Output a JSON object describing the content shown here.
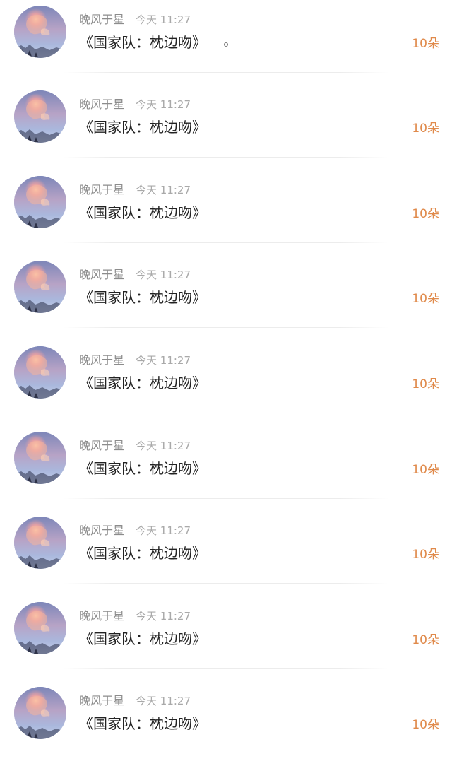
{
  "gift_list": {
    "items": [
      {
        "username": "晚风于星",
        "time": "今天 11:27",
        "message": "《国家队：枕边吻》",
        "amount": "10朵"
      },
      {
        "username": "晚风于星",
        "time": "今天 11:27",
        "message": "《国家队：枕边吻》",
        "amount": "10朵"
      },
      {
        "username": "晚风于星",
        "time": "今天 11:27",
        "message": "《国家队：枕边吻》",
        "amount": "10朵"
      },
      {
        "username": "晚风于星",
        "time": "今天 11:27",
        "message": "《国家队：枕边吻》",
        "amount": "10朵"
      },
      {
        "username": "晚风于星",
        "time": "今天 11:27",
        "message": "《国家队：枕边吻》",
        "amount": "10朵"
      },
      {
        "username": "晚风于星",
        "time": "今天 11:27",
        "message": "《国家队：枕边吻》",
        "amount": "10朵"
      },
      {
        "username": "晚风于星",
        "time": "今天 11:27",
        "message": "《国家队：枕边吻》",
        "amount": "10朵"
      },
      {
        "username": "晚风于星",
        "time": "今天 11:27",
        "message": "《国家队：枕边吻》",
        "amount": "10朵"
      },
      {
        "username": "晚风于星",
        "time": "今天 11:27",
        "message": "《国家队：枕边吻》",
        "amount": "10朵"
      }
    ]
  },
  "colors": {
    "amount_accent": "#e08a4b",
    "username_gray": "#8c8c8c",
    "message_text": "#222222"
  },
  "icons": {
    "avatar": "sunset-sky-avatar"
  }
}
